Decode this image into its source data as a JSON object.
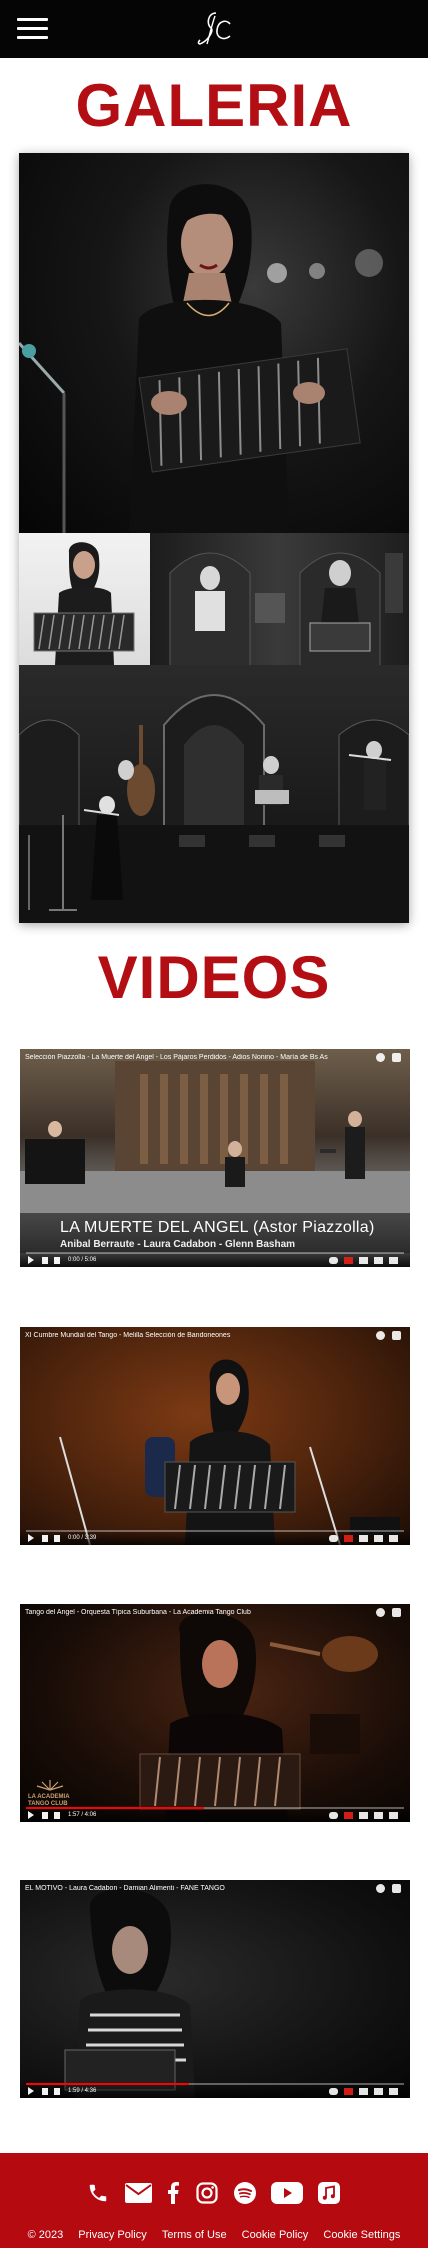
{
  "header": {
    "menu_icon": "hamburger-menu-icon",
    "logo_icon": "lc-monogram-logo"
  },
  "gallery": {
    "title": "GALERIA"
  },
  "videos": {
    "title": "VIDEOS",
    "items": [
      {
        "title": "Selección Piazzolla - La Muerte del Angel - Los Pájaros Perdidos - Adios Nonino - María de Bs As",
        "overlay_caption": "LA MUERTE DEL ANGEL (Astor Piazzolla)",
        "overlay_sub": "Anibal Berraute - Laura Cadabon - Glenn Basham",
        "time": "0:00 / 5:06",
        "progress": 0.0
      },
      {
        "title": "XI Cumbre Mundial del Tango - Melilla Selección de Bandoneones",
        "time": "0:00 / 3:39",
        "progress": 0.0
      },
      {
        "title": "Tango del Angel - Orquesta Típica Suburbana - La Academia Tango Club",
        "time": "1:57 / 4:06",
        "progress": 0.47,
        "logo_line1": "LA ACADEMIA",
        "logo_line2": "TANGO CLUB"
      },
      {
        "title": "EL MOTIVO - Laura Cadabon - Damian Alimenti - FANE TANGO",
        "time": "1:59 / 4:36",
        "progress": 0.43
      }
    ]
  },
  "footer": {
    "social_icons": [
      "phone-icon",
      "email-icon",
      "facebook-icon",
      "instagram-icon",
      "spotify-icon",
      "youtube-icon",
      "music-note-icon"
    ],
    "copyright": "© 2023",
    "links": [
      "Privacy Policy",
      "Terms of Use",
      "Cookie Policy",
      "Cookie Settings"
    ]
  },
  "colors": {
    "brand_red": "#b30e14",
    "footer_red": "#b40a10",
    "header_black": "#050505"
  }
}
